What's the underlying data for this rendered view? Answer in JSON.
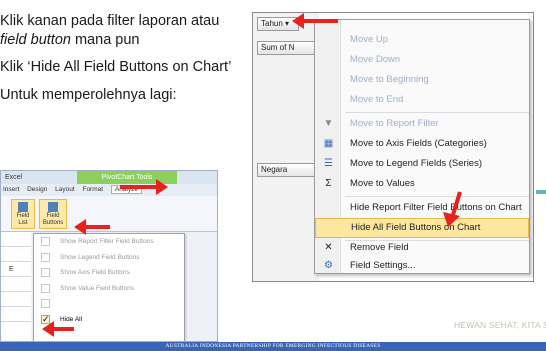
{
  "instructions": {
    "line1_a": "Klik kanan pada filter laporan atau ",
    "line1_em": "field button",
    "line1_b": " mana pun",
    "line2": "Klik ‘Hide All Field Buttons on Chart’",
    "line3": "Untuk memperolehnya lagi:"
  },
  "ribbon": {
    "title": "Excel",
    "context_tab": "PivotChart Tools",
    "tabs": [
      "Insert",
      "Design",
      "Layout",
      "Format",
      "Analyze"
    ],
    "buttons": [
      {
        "label": "Field List",
        "icon": "field-list-icon"
      },
      {
        "label": "Field Buttons",
        "icon": "field-buttons-icon"
      }
    ],
    "grid_rows": [
      "",
      "",
      "E",
      "",
      "",
      ""
    ],
    "dropdown": [
      {
        "label": "Show Report Filter Field Buttons",
        "checked": false
      },
      {
        "label": "Show Legend Field Buttons",
        "checked": false
      },
      {
        "label": "Show Axis Field Buttons",
        "checked": false
      },
      {
        "label": "Show Value Field Buttons",
        "checked": false
      },
      {
        "label": "",
        "checked": false
      },
      {
        "label": "Hide All",
        "checked": true
      }
    ]
  },
  "pivot": {
    "field_tahun": "Tahun",
    "field_sum": "Sum of N",
    "field_negara": "Negara"
  },
  "context_menu": {
    "items": [
      {
        "label": "Move Up",
        "icon": "",
        "disabled": true
      },
      {
        "label": "Move Down",
        "icon": "",
        "disabled": true
      },
      {
        "label": "Move to Beginning",
        "icon": "",
        "disabled": true
      },
      {
        "label": "Move to End",
        "icon": "",
        "disabled": true
      },
      {
        "label": "Move to Report Filter",
        "icon": "filter-icon",
        "disabled": true
      },
      {
        "label": "Move to Axis Fields (Categories)",
        "icon": "axis-icon",
        "disabled": false
      },
      {
        "label": "Move to Legend Fields (Series)",
        "icon": "legend-icon",
        "disabled": false
      },
      {
        "label": "Move to Values",
        "icon": "sigma-icon",
        "disabled": false
      },
      {
        "label": "Hide Report Filter Field Buttons on Chart",
        "icon": "",
        "disabled": false
      },
      {
        "label": "Hide All Field Buttons on Chart",
        "icon": "",
        "disabled": false,
        "highlighted": true
      },
      {
        "label": "Remove Field",
        "icon": "remove-icon",
        "disabled": false
      },
      {
        "label": "Field Settings...",
        "icon": "settings-icon",
        "disabled": false
      }
    ]
  },
  "watermark": "HEWAN SEHAT, KITA SEHAT",
  "footer": "AUSTRALIA INDONESIA PARTNERSHIP FOR EMERGING INFECTIOUS DISEASES",
  "colors": {
    "arrow": "#e8211c",
    "footer": "#3a64b8",
    "highlight": "#fde6a0",
    "ribbon_context": "#8ccf5b"
  }
}
